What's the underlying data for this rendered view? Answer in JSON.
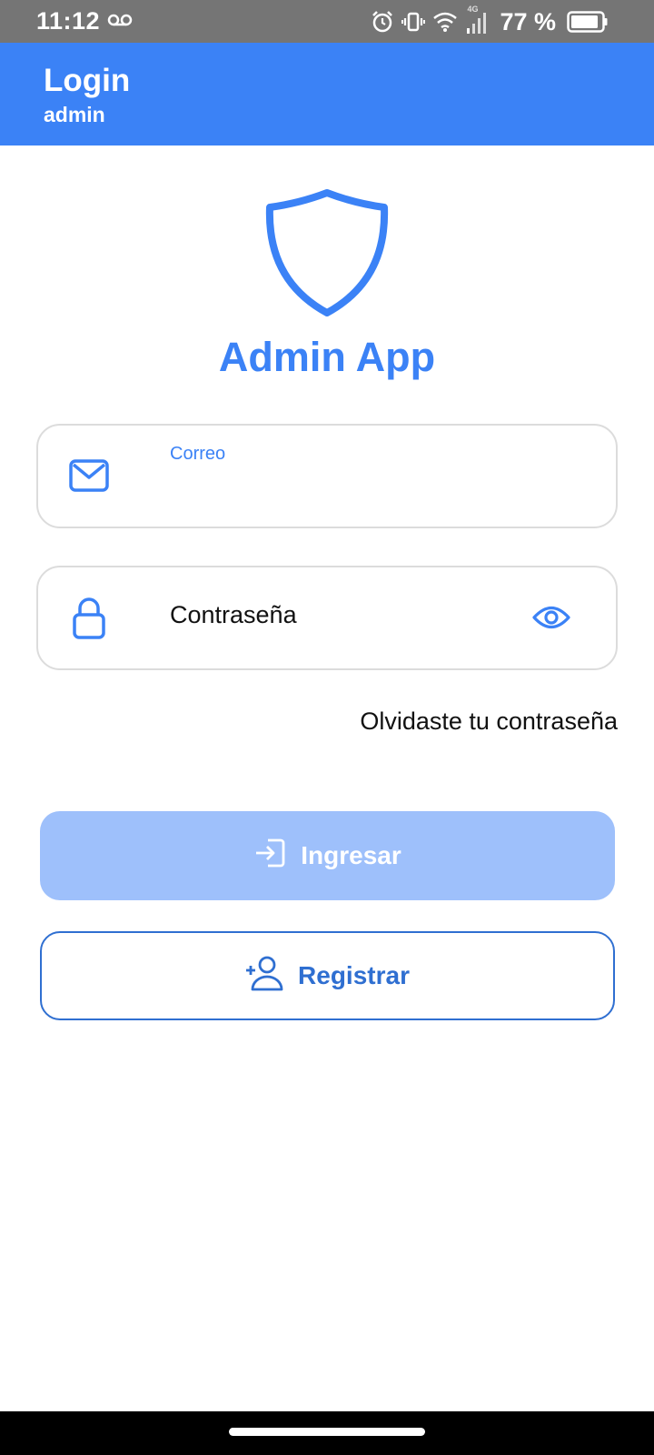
{
  "status_bar": {
    "time": "11:12",
    "battery_percent": "77 %",
    "network": "4G",
    "icons": [
      "voicemail-icon",
      "alarm-icon",
      "vibrate-icon",
      "wifi-icon",
      "signal-icon",
      "battery-icon"
    ]
  },
  "app_bar": {
    "title": "Login",
    "subtitle": "admin"
  },
  "brand": {
    "name": "Admin App",
    "icon": "shield-icon"
  },
  "form": {
    "email": {
      "label": "Correo",
      "icon": "mail-icon",
      "value": ""
    },
    "password": {
      "placeholder": "Contraseña",
      "icon": "lock-icon",
      "toggle_icon": "eye-icon",
      "value": ""
    },
    "forgot_link": "Olvidaste tu contraseña"
  },
  "buttons": {
    "login": {
      "label": "Ingresar",
      "icon": "login-icon",
      "enabled": false
    },
    "register": {
      "label": "Registrar",
      "icon": "add-user-icon"
    }
  },
  "colors": {
    "primary": "#3b82f6",
    "primary_disabled": "#9ec0fb",
    "outline_button": "#2f6fd1",
    "status_bar": "#757575",
    "field_border": "#dcdcdc"
  }
}
